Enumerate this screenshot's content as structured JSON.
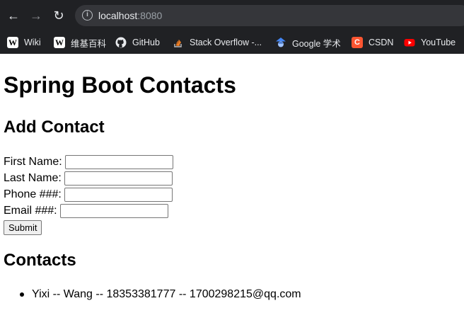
{
  "browser": {
    "url_host": "localhost",
    "url_port": ":8080",
    "bookmarks": [
      {
        "label": "Wiki",
        "icon": "wikipedia-icon"
      },
      {
        "label": "维基百科",
        "icon": "wikipedia-icon"
      },
      {
        "label": "GitHub",
        "icon": "github-icon"
      },
      {
        "label": "Stack Overflow -...",
        "icon": "stackoverflow-icon"
      },
      {
        "label": "Google 学术",
        "icon": "google-scholar-icon"
      },
      {
        "label": "CSDN",
        "icon": "csdn-icon"
      },
      {
        "label": "YouTube",
        "icon": "youtube-icon"
      }
    ]
  },
  "page": {
    "title": "Spring Boot Contacts",
    "add_heading": "Add Contact",
    "form": {
      "first_name_label": "First Name:",
      "last_name_label": "Last Name:",
      "phone_label": "Phone ###:",
      "email_label": "Email ###:",
      "first_name_value": "",
      "last_name_value": "",
      "phone_value": "",
      "email_value": "",
      "submit_label": "Submit"
    },
    "contacts_heading": "Contacts",
    "contacts": [
      {
        "text": "Yixi -- Wang -- 18353381777 -- 1700298215@qq.com"
      }
    ]
  }
}
